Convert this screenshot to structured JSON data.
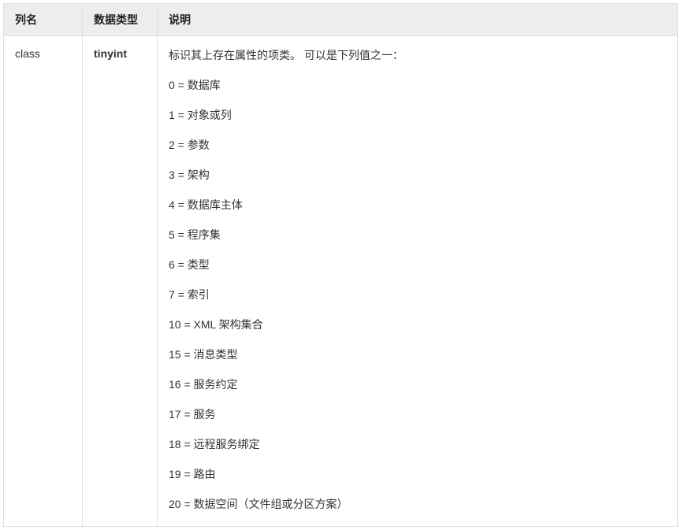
{
  "headers": {
    "col_name": "列名",
    "data_type": "数据类型",
    "description": "说明"
  },
  "row": {
    "name": "class",
    "type": "tinyint",
    "desc_intro": "标识其上存在属性的项类。 可以是下列值之一：",
    "values": [
      "0 = 数据库",
      "1 = 对象或列",
      "2 = 参数",
      "3 = 架构",
      "4 = 数据库主体",
      "5 = 程序集",
      "6 = 类型",
      "7 = 索引",
      "10 = XML 架构集合",
      "15 = 消息类型",
      "16 = 服务约定",
      "17 = 服务",
      "18 = 远程服务绑定",
      "19 = 路由",
      "20 = 数据空间（文件组或分区方案）"
    ]
  }
}
